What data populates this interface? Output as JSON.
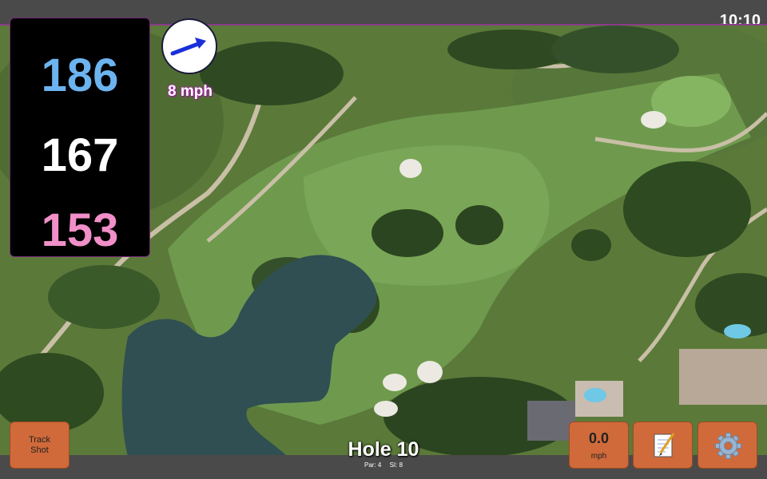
{
  "status": {
    "time": "10:10"
  },
  "distances": {
    "back": "186",
    "center": "167",
    "front": "153"
  },
  "wind": {
    "speed_label": "8 mph",
    "icon": "wind-arrow-icon"
  },
  "buttons": {
    "track_line1": "Track",
    "track_line2": "Shot",
    "speed_value": "0.0",
    "speed_unit": "mph",
    "notes_icon": "notepad-icon",
    "settings_icon": "gear-icon"
  },
  "hole": {
    "title": "Hole 10",
    "par": "Par: 4",
    "si": "SI: 8"
  },
  "colors": {
    "back_distance": "#6cb4f0",
    "center_distance": "#ffffff",
    "front_distance": "#f08fc8",
    "button": "#d06a3a",
    "bar": "#4a4a4a"
  }
}
